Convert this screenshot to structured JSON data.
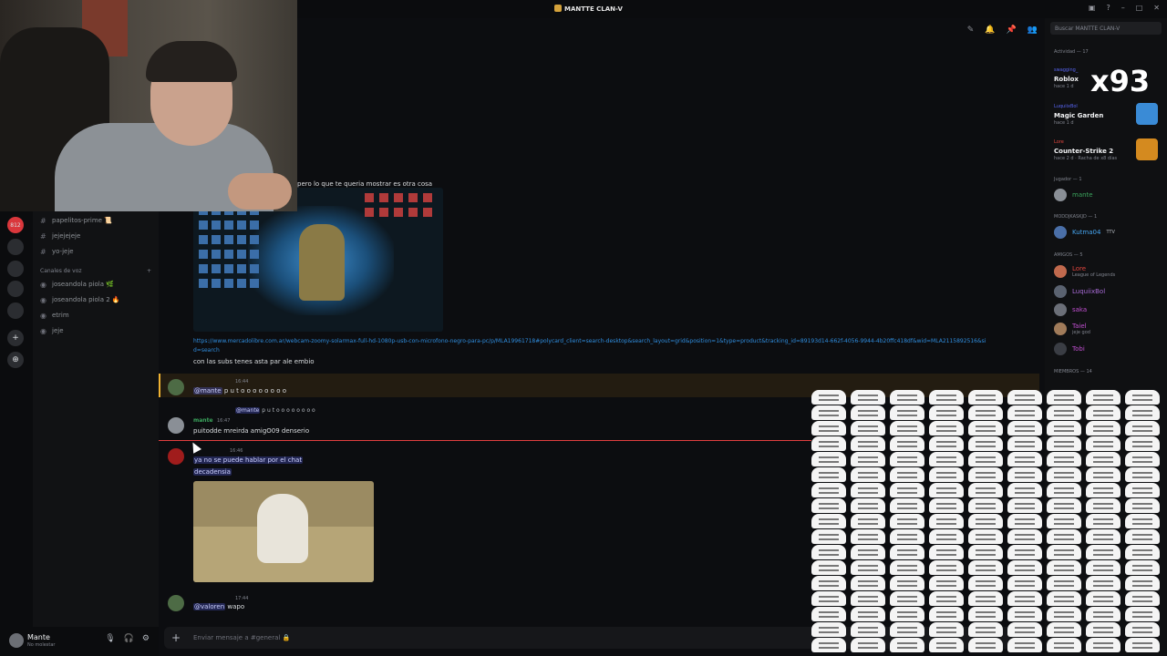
{
  "window": {
    "title": "MANTTE CLAN-V"
  },
  "servers": [
    {
      "label": "812",
      "icon": "server-icon"
    },
    {
      "label": "",
      "icon": "server-icon"
    },
    {
      "label": "",
      "icon": "server-icon"
    },
    {
      "label": "+",
      "icon": "add-server-icon"
    },
    {
      "label": "⊕",
      "icon": "discover-icon"
    }
  ],
  "channels": {
    "text": [
      {
        "name": "papelitos-prime 📜"
      },
      {
        "name": "jejejejeje"
      },
      {
        "name": "yo-jeje"
      }
    ],
    "voice_category": "Canales de voz",
    "voice": [
      {
        "name": "joseandola piola 🌿"
      },
      {
        "name": "joseandola piola 2 🔥"
      },
      {
        "name": "etrim"
      },
      {
        "name": "jeje"
      }
    ]
  },
  "user": {
    "name": "Mante",
    "status": "No molestar"
  },
  "messages": {
    "caption": "pero lo que te queria mostrar es otra cosa",
    "link": "https://www.mercadolibre.com.ar/webcam-zoomy-solarmax-full-hd-1080p-usb-con-microfono-negro-para-pc/p/MLA19961718#polycard_client=search-desktop&search_layout=grid&position=1&type=product&tracking_id=89193d14-662f-4056-9944-4b20ffc418df&wid=MLA2115892516&sid=search",
    "link_text": "con las subs tenes asta par ale embio",
    "m1": {
      "time": "16:44",
      "mention": "@mante",
      "text": "p u t o o o  o o o o o"
    },
    "m2": {
      "reply_mention": "@mante",
      "reply_text": "p u t o o o  o o o o o",
      "user": "mante",
      "time": "16:47",
      "text": "puitodde mreirda amigO09 denserio"
    },
    "m3": {
      "time": "16:46",
      "line1": "ya no se puede hablar por el chat",
      "line2": "decadensia"
    },
    "m4": {
      "time": "17:44",
      "mention": "@valoren",
      "text": "wapo"
    }
  },
  "composer": {
    "placeholder": "Enviar mensaje a #general 🔒"
  },
  "members": {
    "search_placeholder": "Buscar MANTTE CLAN-V",
    "activity_header": "Actividad — 17",
    "activities": [
      {
        "user": "swagging_",
        "game": "Roblox",
        "since": "hace 1 d"
      },
      {
        "user": "LuquiixBol",
        "game": "Magic Garden",
        "since": "hace 1 d"
      },
      {
        "user": "Lore",
        "game": "Counter-Strike 2",
        "since": "hace 2 d · Racha de x8 días"
      }
    ],
    "jugador_header": "Jugador — 1",
    "jugador": [
      {
        "name": "mante"
      }
    ],
    "mod_header": "MODDJKASKJD — 1",
    "mods": [
      {
        "name": "Kutma04",
        "badge": "TTV"
      }
    ],
    "amigos_header": "AMIGOS — 5",
    "amigos": [
      {
        "name": "Lore",
        "sub": "League of Legends"
      },
      {
        "name": "LuquiixBol",
        "sub": ""
      },
      {
        "name": "saka",
        "sub": ""
      },
      {
        "name": "Taiel",
        "sub": "jeje god"
      },
      {
        "name": "Tobi",
        "sub": ""
      }
    ],
    "miembros_header": "MIEMBROS — 14"
  },
  "overlay": {
    "counter": "x93"
  },
  "colors": {
    "accent": "#5865f2",
    "mention_bg": "#3b3f88",
    "link": "#2f8dde",
    "new_line": "#e23f3f",
    "online": "#23a55a",
    "highlight": "#f0b232"
  }
}
